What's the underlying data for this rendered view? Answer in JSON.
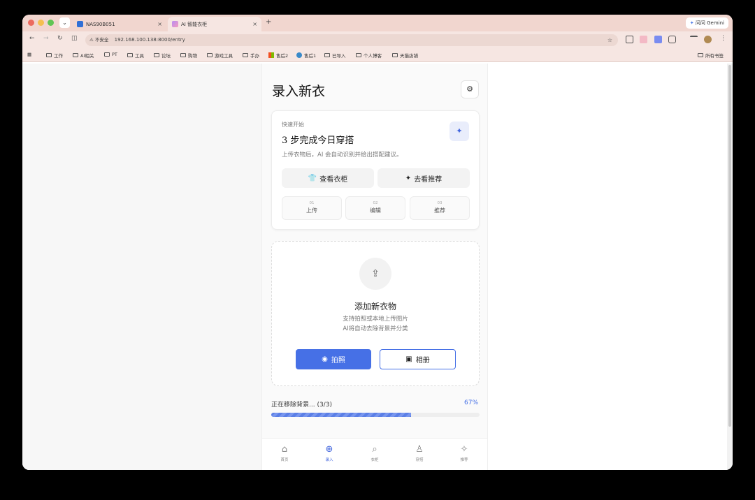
{
  "browser": {
    "tabs": [
      {
        "title": "NAS90B051"
      },
      {
        "title": "AI 智能衣柜"
      }
    ],
    "gemini_label": "问问 Gemini",
    "security_label": "不安全",
    "url": "192.168.100.138:8000/entry",
    "bookmarks": [
      "工作",
      "AI相关",
      "PT",
      "工具",
      "论坛",
      "购物",
      "游戏工具",
      "手办",
      "售后2",
      "售后1",
      "已导入",
      "个人博客",
      "天猫店铺"
    ],
    "all_bookmarks": "所有书签"
  },
  "page": {
    "title": "录入新衣"
  },
  "quickstart": {
    "kicker": "快速开始",
    "title": "3 步完成今日穿搭",
    "subtitle": "上传衣物后，AI 会自动识别并给出搭配建议。",
    "btn_wardrobe": "查看衣柜",
    "btn_recommend": "去看推荐",
    "steps": [
      {
        "num": "01",
        "label": "上传"
      },
      {
        "num": "02",
        "label": "编辑"
      },
      {
        "num": "03",
        "label": "推荐"
      }
    ]
  },
  "upload": {
    "title": "添加新衣物",
    "desc1": "支持拍照或本地上传图片",
    "desc2": "AI将自动去除背景并分类",
    "btn_camera": "拍照",
    "btn_album": "相册"
  },
  "progress": {
    "text": "正在移除背景... (3/3)",
    "percent_label": "67%",
    "value": 0.67
  },
  "nav": [
    {
      "label": "首页",
      "icon": "home-icon"
    },
    {
      "label": "录入",
      "icon": "plus-circle-icon"
    },
    {
      "label": "衣柜",
      "icon": "search-icon"
    },
    {
      "label": "穿搭",
      "icon": "person-icon"
    },
    {
      "label": "推荐",
      "icon": "sparkle-icon"
    }
  ]
}
